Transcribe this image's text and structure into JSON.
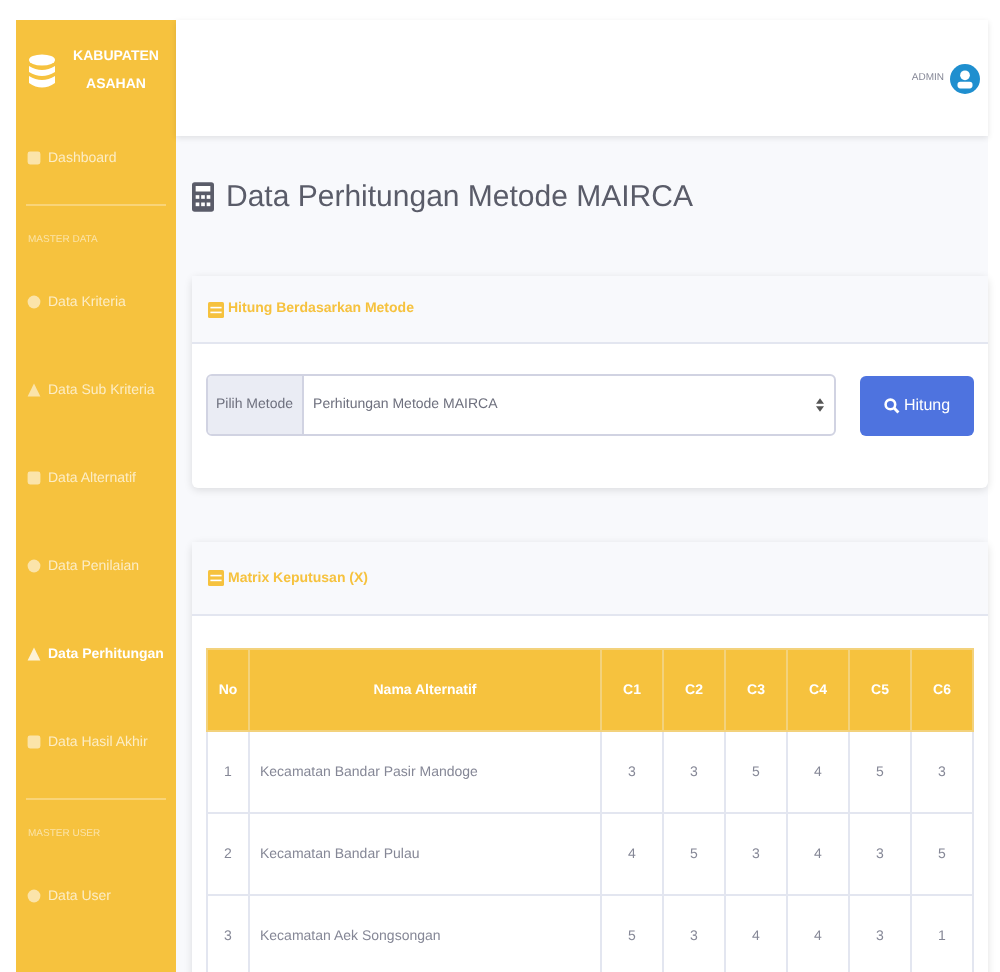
{
  "sidebar": {
    "brand": "KABUPATEN ASAHAN",
    "items": [
      {
        "kind": "link",
        "label": "Dashboard",
        "selected": false
      },
      {
        "kind": "divider"
      },
      {
        "kind": "heading",
        "label": "MASTER DATA"
      },
      {
        "kind": "link",
        "label": "Data Kriteria",
        "selected": false
      },
      {
        "kind": "link",
        "label": "Data Sub Kriteria",
        "selected": false
      },
      {
        "kind": "link",
        "label": "Data Alternatif",
        "selected": false
      },
      {
        "kind": "link",
        "label": "Data Penilaian",
        "selected": false
      },
      {
        "kind": "link",
        "label": "Data Perhitungan",
        "selected": true
      },
      {
        "kind": "link",
        "label": "Data Hasil Akhir",
        "selected": false
      },
      {
        "kind": "divider"
      },
      {
        "kind": "heading",
        "label": "MASTER USER"
      },
      {
        "kind": "link",
        "label": "Data User",
        "selected": false
      }
    ]
  },
  "topbar": {
    "user": "ADMIN"
  },
  "page_title": "Data Perhitungan Metode MAIRCA",
  "method_card": {
    "title": "Hitung Berdasarkan Metode",
    "select_label": "Pilih Metode",
    "select_value": "Perhitungan Metode MAIRCA",
    "button": "Hitung"
  },
  "matrix_card": {
    "title": "Matrix Keputusan (X)",
    "columns": [
      "No",
      "Nama Alternatif",
      "C1",
      "C2",
      "C3",
      "C4",
      "C5",
      "C6"
    ],
    "rows": [
      [
        "1",
        "Kecamatan Bandar Pasir Mandoge",
        "3",
        "3",
        "5",
        "4",
        "5",
        "3"
      ],
      [
        "2",
        "Kecamatan Bandar Pulau",
        "4",
        "5",
        "3",
        "4",
        "3",
        "5"
      ],
      [
        "3",
        "Kecamatan Aek Songsongan",
        "5",
        "3",
        "4",
        "4",
        "3",
        "1"
      ]
    ]
  }
}
